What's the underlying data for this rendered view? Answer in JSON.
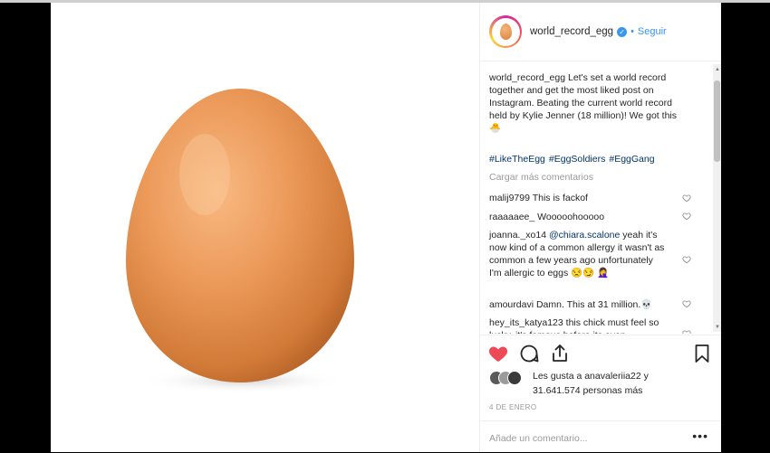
{
  "post": {
    "username": "world_record_egg",
    "follow_separator": "•",
    "follow_label": "Seguir",
    "verified_glyph": "✓"
  },
  "caption": {
    "username": "world_record_egg",
    "text": "Let's set a world record together and get the most liked post on Instagram. Beating the current world record held by Kylie Jenner (18 million)! We got this 🐣",
    "hashtags": [
      "#LikeTheEgg",
      "#EggSoldiers",
      "#EggGang"
    ]
  },
  "load_more": "Cargar más comentarios",
  "comments": [
    {
      "user": "malij9799",
      "text": "This is fackof"
    },
    {
      "user": "raaaaaee_",
      "text": "Wooooohooooo"
    },
    {
      "user": "joanna._xo14",
      "mention": "@chiara.scalone",
      "text": "yeah it's now kind of a common allergy it wasn't as common a few years ago unfortunately I'm allergic to eggs 😒😏 🤦‍♀️"
    },
    {
      "user": "amourdavi",
      "text": "Damn. This at 31 million.💀"
    },
    {
      "user": "hey_its_katya123",
      "text": "this chick must feel so lucky, it's famous before its even"
    }
  ],
  "likes": {
    "line1": "Les gusta a anavaleriia22 y",
    "line2": "31.641.574 personas más"
  },
  "date": "4 DE ENERO",
  "add_comment_placeholder": "Añade un comentario...",
  "more_label": "•••",
  "colors": {
    "like_red": "#ed4956",
    "link_blue": "#3897f0",
    "hashtag": "#003569"
  },
  "icons": {
    "like": "heart-filled-icon",
    "comment": "comment-bubble-icon",
    "share": "share-icon",
    "save": "bookmark-icon"
  }
}
